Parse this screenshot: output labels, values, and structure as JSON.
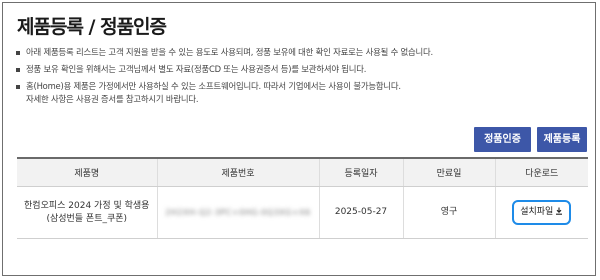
{
  "page": {
    "title": "제품등록 / 정품인증"
  },
  "notices": [
    {
      "lines": [
        "아래 제품등록 리스트는 고객 지원을 받을 수 있는 용도로 사용되며, 정품 보유에 대한 확인 자료로는 사용될 수 없습니다."
      ]
    },
    {
      "lines": [
        "정품 보유 확인을 위해서는 고객님께서 별도 자료(정품CD 또는 사용권증서 등)를 보관하셔야 됩니다."
      ]
    },
    {
      "lines": [
        "홈(Home)용 제품은 가정에서만 사용하실 수 있는 소프트웨어입니다. 따라서 기업에서는 사용이 불가능합니다.",
        "자세한 사항은 사용권 증서를 참고하시기 바랍니다."
      ]
    }
  ],
  "buttons": {
    "auth_label": "정품인증",
    "register_label": "제품등록",
    "primary_color": "#3d57a8"
  },
  "table": {
    "headers": [
      "제품명",
      "제품번호",
      "등록일자",
      "만료일",
      "다운로드"
    ],
    "rows": [
      {
        "product_name": "한컴오피스 2024 가정 및 학생용 (삼성번들 폰트_쿠폰)",
        "serial": "2H2XH-Q2-3PC+0HG-0Q3XG+X6",
        "registered": "2025-05-27",
        "expiry": "영구",
        "download_label": "설치파일",
        "download_icon": "download-icon"
      }
    ]
  },
  "colors": {
    "highlight_border": "#1e8be8"
  }
}
